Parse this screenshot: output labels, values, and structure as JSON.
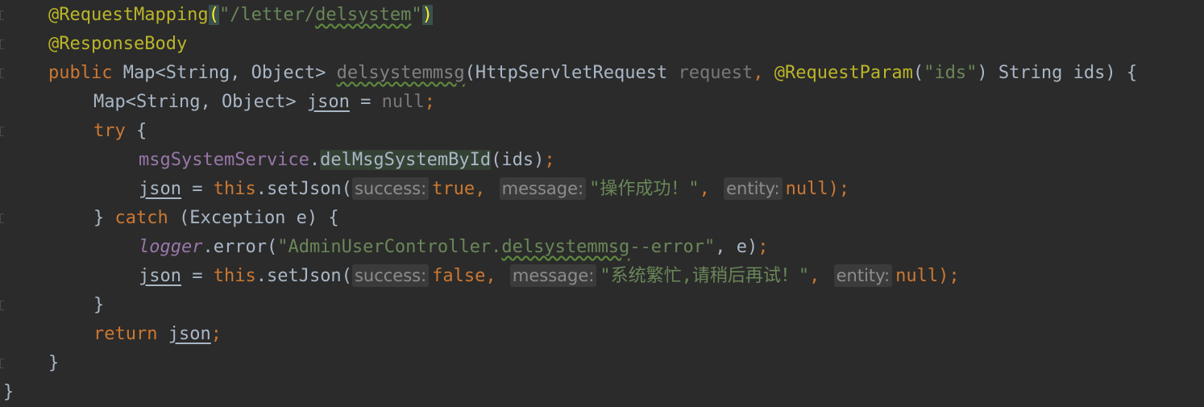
{
  "code": {
    "l1": {
      "ann": "@RequestMapping",
      "open": "(",
      "str_a": "\"/letter/",
      "str_b": "delsystem",
      "str_c": "\"",
      "close": ")"
    },
    "l2": {
      "ann": "@ResponseBody"
    },
    "l3": {
      "kw": "public",
      "type": " Map<String, Object> ",
      "method": "delsystemmsg",
      "p1": "(HttpServletRequest ",
      "p1name": "request",
      "comma": ", ",
      "ann": "@RequestParam",
      "p2open": "(",
      "p2str": "\"ids\"",
      "p2rest": ") String ids) {"
    },
    "l4": {
      "type": "Map<String, Object> ",
      "var": "json",
      "eq": " = ",
      "val": "null",
      "semi": ";"
    },
    "l5": {
      "kw": "try",
      "brace": " {"
    },
    "l6": {
      "field": "msgSystemService",
      "dot": ".",
      "call": "delMsgSystemById",
      "args": "(ids)",
      "semi": ";"
    },
    "l7": {
      "var": "json",
      "eq": " = ",
      "kw": "this",
      "call": ".setJson(",
      "h1": "success:",
      "v1": "true",
      "c1": ",",
      "h2": "message:",
      "v2": "\"操作成功！\"",
      "c2": ",",
      "h3": "entity:",
      "v3": "null",
      "end": ");"
    },
    "l8": {
      "open": "} ",
      "kw": "catch",
      "rest": " (Exception e) {"
    },
    "l9": {
      "logger": "logger",
      "call": ".error(",
      "s1": "\"AdminUserController.",
      "s2": "delsystemmsg",
      "s3": "--error\"",
      "rest": ", e)",
      "semi": ";"
    },
    "l10": {
      "var": "json",
      "eq": " = ",
      "kw": "this",
      "call": ".setJson(",
      "h1": "success:",
      "v1": "false",
      "c1": ",",
      "h2": "message:",
      "v2": "\"系统繁忙,请稍后再试！\"",
      "c2": ",",
      "h3": "entity:",
      "v3": "null",
      "end": ");"
    },
    "l11": {
      "brace": "}"
    },
    "l12": {
      "kw": "return",
      "sp": " ",
      "var": "json",
      "semi": ";"
    },
    "l13": {
      "brace": "}"
    },
    "l14": {
      "brace": "}"
    }
  },
  "colors": {
    "background": "#2b2b2b",
    "default_text": "#a9b7c6",
    "annotation": "#bbb529",
    "string": "#6a8759",
    "keyword": "#cc7832",
    "field": "#9876aa",
    "unused": "#787878"
  }
}
